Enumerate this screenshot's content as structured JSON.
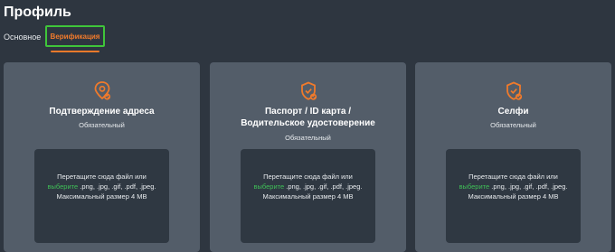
{
  "header": {
    "title": "Профиль"
  },
  "tabs": [
    {
      "label": "Основное"
    },
    {
      "label": "Верификация"
    }
  ],
  "colors": {
    "accent": "#f07a2b",
    "highlight": "#3fc53a",
    "link": "#3fbf57",
    "card": "#535d69",
    "drop": "#2f3842",
    "background": "#2e3640"
  },
  "cards": [
    {
      "title_line1": "Подтверждение адреса",
      "title_line2": "",
      "required": "Обязательный",
      "icon": "pin-check-icon",
      "drop_text_before": "Перетащите сюда файл или",
      "drop_link": "выберите",
      "drop_text_after": " .png, .jpg, .gif, .pdf, .jpeg. Максимальный размер 4 MB"
    },
    {
      "title_line1": "Паспорт / ID карта /",
      "title_line2": "Водительское удостоверение",
      "required": "Обязательный",
      "icon": "shield-check-icon",
      "drop_text_before": "Перетащите сюда файл или",
      "drop_link": "выберите",
      "drop_text_after": " .png, .jpg, .gif, .pdf, .jpeg. Максимальный размер 4 MB"
    },
    {
      "title_line1": "Селфи",
      "title_line2": "",
      "required": "Обязательный",
      "icon": "shield-check-icon",
      "drop_text_before": "Перетащите сюда файл или",
      "drop_link": "выберите",
      "drop_text_after": " .png, .jpg, .gif, .pdf, .jpeg. Максимальный размер 4 MB"
    }
  ]
}
